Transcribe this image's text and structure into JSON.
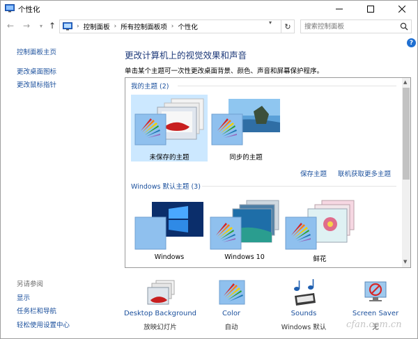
{
  "window": {
    "title": "个性化"
  },
  "address": {
    "crumbs": [
      "控制面板",
      "所有控制面板项",
      "个性化"
    ],
    "search_placeholder": "搜索控制面板"
  },
  "left_pane": {
    "links": [
      "控制面板主页",
      "更改桌面图标",
      "更改鼠标指针"
    ],
    "see_also_label": "另请参阅",
    "see_also_links": [
      "显示",
      "任务栏和导航",
      "轻松使用设置中心"
    ]
  },
  "main": {
    "heading": "更改计算机上的视觉效果和声音",
    "subheading": "单击某个主题可一次性更改桌面背景、颜色、声音和屏幕保护程序。",
    "my_themes_label": "我的主题 (2)",
    "my_themes": [
      {
        "name": "未保存的主题",
        "selected": true
      },
      {
        "name": "同步的主题",
        "selected": false
      }
    ],
    "save_theme_link": "保存主题",
    "get_more_link": "联机获取更多主题",
    "default_themes_label": "Windows 默认主题 (3)",
    "default_themes": [
      {
        "name": "Windows"
      },
      {
        "name": "Windows 10"
      },
      {
        "name": "鲜花"
      }
    ]
  },
  "settings": [
    {
      "name": "Desktop Background",
      "value": "放映幻灯片",
      "icon": "desktop-background-icon"
    },
    {
      "name": "Color",
      "value": "自动",
      "icon": "color-icon"
    },
    {
      "name": "Sounds",
      "value": "Windows 默认",
      "icon": "sounds-icon"
    },
    {
      "name": "Screen Saver",
      "value": "无",
      "icon": "screen-saver-icon"
    }
  ],
  "watermark": "cfan.com.cn",
  "colors": {
    "link": "#1a4f9c",
    "heading": "#1e3a7a",
    "selected": "#cce8ff",
    "help": "#1f6fd1"
  }
}
